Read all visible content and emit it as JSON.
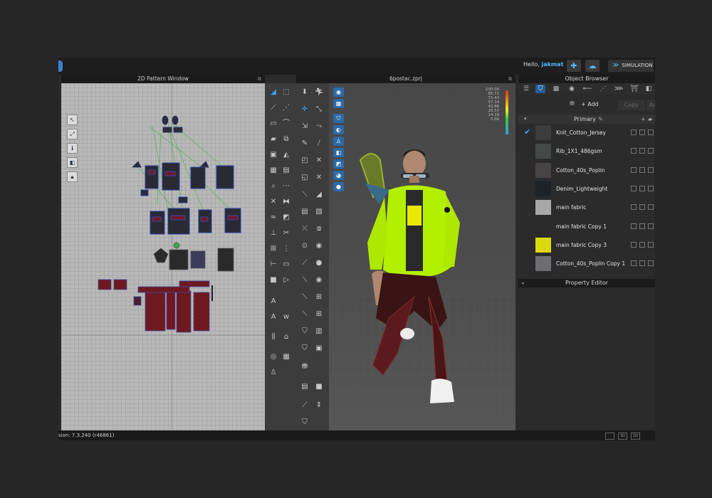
{
  "header": {
    "greeting": "Hello,",
    "username": "jakmat",
    "simulation_label": "SIMULATION"
  },
  "panes": {
    "pattern_title": "2D Pattern Window",
    "viewport_title": "6postac.zprj"
  },
  "viewport": {
    "scale_values": [
      "100.00",
      "85.71",
      "71.43",
      "57.14",
      "42.86",
      "28.57",
      "14.29",
      "0.00"
    ]
  },
  "object_browser": {
    "title": "Object Browser",
    "add_label": "+ Add",
    "copy_label": "Copy",
    "assign_label": "Assig",
    "group_label": "Primary",
    "fabrics": [
      {
        "name": "Knit_Cotton_Jersey",
        "color": "#3d3d3d",
        "selected": true
      },
      {
        "name": "Rib_1X1_486gsm",
        "color": "#444846",
        "selected": false
      },
      {
        "name": "Cotton_40s_Poplin",
        "color": "#464444",
        "selected": false
      },
      {
        "name": "Denim_Lightweight",
        "color": "#1e2227",
        "selected": false
      },
      {
        "name": "main fabric",
        "color": "#a8a8a8",
        "selected": false
      },
      {
        "name": "main fabric Copy 1",
        "color": "#2a2a2a",
        "selected": false
      },
      {
        "name": "main fabric Copy 3",
        "color": "#dcd90d",
        "selected": false
      },
      {
        "name": "Cotton_40s_Poplin Copy 1",
        "color": "#6e6e70",
        "selected": false
      }
    ]
  },
  "property_editor": {
    "title": "Property Editor"
  },
  "status": {
    "version": "sion: 7.3.240 (r46861)"
  },
  "colors": {
    "accent": "#3aa8ff",
    "jacket": "#b3f000",
    "pants": "#7a1a22"
  }
}
